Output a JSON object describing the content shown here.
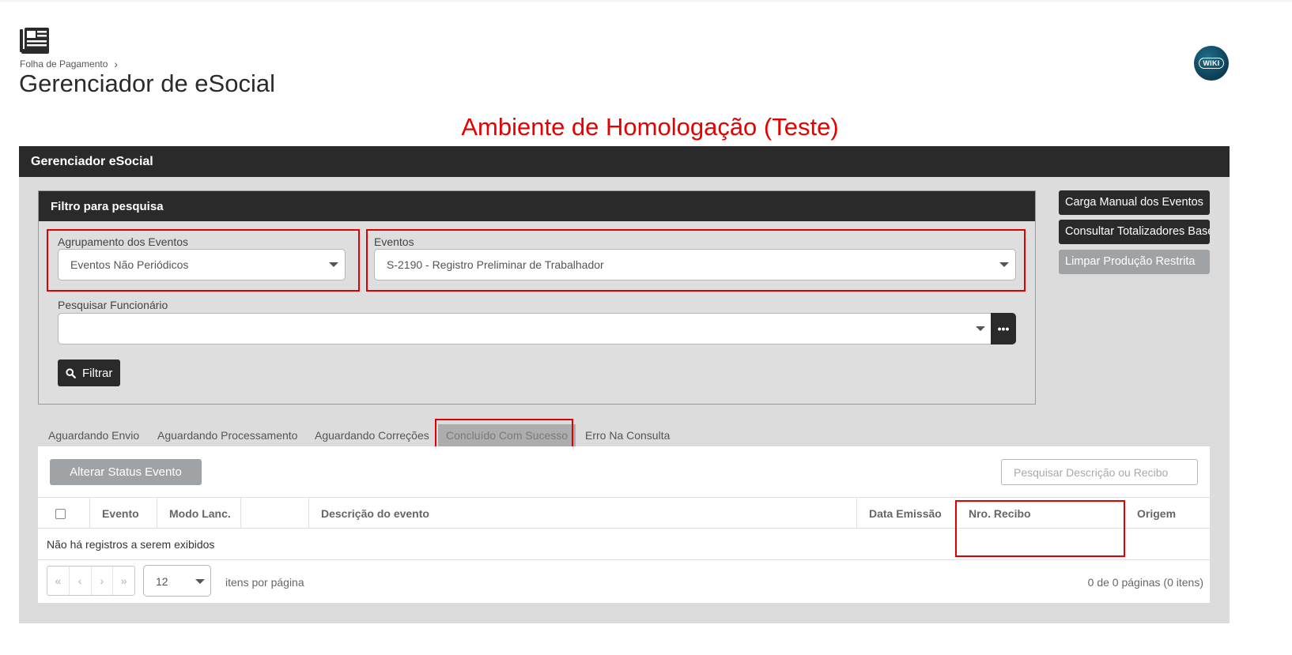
{
  "breadcrumb": {
    "parent": "Folha de Pagamento"
  },
  "page_title": "Gerenciador de eSocial",
  "environment_banner": "Ambiente de Homologação (Teste)",
  "wiki_label": "WIKI",
  "main_panel": {
    "title": "Gerenciador eSocial"
  },
  "filter": {
    "title": "Filtro para pesquisa",
    "grouping_label": "Agrupamento dos Eventos",
    "grouping_value": "Eventos Não Periódicos",
    "events_label": "Eventos",
    "events_value": "S-2190 - Registro Preliminar de Trabalhador",
    "employee_label": "Pesquisar Funcionário",
    "employee_value": "",
    "more_label": "•••",
    "filter_button": "Filtrar"
  },
  "side_buttons": {
    "manual_load": "Carga Manual dos Eventos",
    "totalizers": "Consultar Totalizadores Base",
    "clear_restricted": "Limpar Produção Restrita"
  },
  "tabs": [
    {
      "label": "Aguardando Envio"
    },
    {
      "label": "Aguardando Processamento"
    },
    {
      "label": "Aguardando Correções"
    },
    {
      "label": "Concluído Com Sucesso",
      "active": true
    },
    {
      "label": "Erro Na Consulta"
    }
  ],
  "grid": {
    "alter_status_button": "Alterar Status Evento",
    "search_placeholder": "Pesquisar Descrição ou Recibo",
    "columns": [
      "Evento",
      "Modo Lanc.",
      "",
      "Descrição do evento",
      "Data Emissão",
      "Nro. Recibo",
      "Origem"
    ],
    "empty_message": "Não há registros a serem exibidos",
    "page_size": "12",
    "per_page_label": "itens por página",
    "page_info": "0 de 0 páginas (0 itens)"
  },
  "colors": {
    "dark": "#2a2a2a",
    "highlight_red": "#e00000",
    "banner_red": "#e60000",
    "disabled_grey": "#a0a3a6"
  },
  "icons": {
    "app": "newspaper-icon",
    "breadcrumb_separator": "chevron-right-icon",
    "filter_button": "search-icon",
    "select_caret": "caret-down-icon",
    "pager_first": "double-chevron-left-icon",
    "pager_prev": "chevron-left-icon",
    "pager_next": "chevron-right-icon",
    "pager_last": "double-chevron-right-icon"
  }
}
